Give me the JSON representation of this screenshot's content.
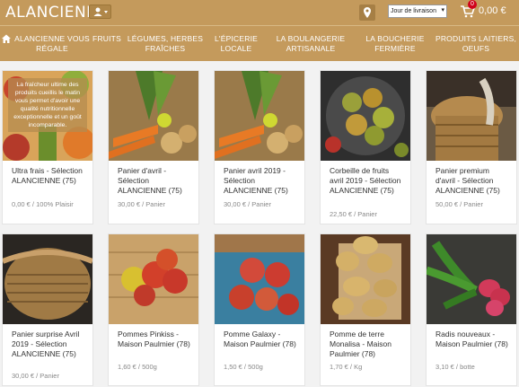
{
  "header": {
    "logo": "ALANCIENNE",
    "delivery_select": "Jour de livraison",
    "cart_count": "0",
    "cart_total": "0,00 €"
  },
  "nav": {
    "items": [
      "ALANCIENNE VOUS RÉGALE",
      "FRUITS",
      "LÉGUMES, HERBES FRAÎCHES",
      "L'ÉPICERIE LOCALE",
      "LA BOULANGERIE ARTISANALE",
      "LA BOUCHERIE FERMIÈRE",
      "PRODUITS LAITIERS, OEUFS"
    ]
  },
  "products": [
    {
      "title": "Ultra frais - Sélection ALANCIENNE (75)",
      "price": "0,00 € / 100% Plaisir",
      "overlay": "La fraîcheur ultime des produits cueillis le matin vous permet d'avoir une qualité nutritionnelle exceptionnelle et un goût incomparable."
    },
    {
      "title": "Panier d'avril - Sélection ALANCIENNE (75)",
      "price": "30,00 € / Panier"
    },
    {
      "title": "Panier avril 2019 - Sélection ALANCIENNE (75)",
      "price": "30,00 € / Panier"
    },
    {
      "title": "Corbeille de fruits avril 2019 - Sélection ALANCIENNE (75)",
      "price": "22,50 € / Panier"
    },
    {
      "title": "Panier premium d'avril - Sélection ALANCIENNE (75)",
      "price": "50,00 € / Panier"
    },
    {
      "title": "Panier surprise Avril 2019 - Sélection ALANCIENNE (75)",
      "price": "30,00 € / Panier"
    },
    {
      "title": "Pommes Pinkiss - Maison Paulmier (78)",
      "price": "1,60 € / 500g"
    },
    {
      "title": "Pomme Galaxy - Maison Paulmier (78)",
      "price": "1,50 € / 500g"
    },
    {
      "title": "Pomme de terre Monalisa - Maison Paulmier (78)",
      "price": "1,70 € / Kg"
    },
    {
      "title": "Radis nouveaux - Maison Paulmier (78)",
      "price": "3,10 € / botte"
    }
  ]
}
